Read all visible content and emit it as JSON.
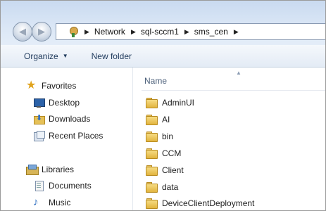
{
  "address": {
    "crumbs": [
      "Network",
      "sql-sccm1",
      "sms_cen"
    ]
  },
  "toolbar": {
    "organize_label": "Organize",
    "new_folder_label": "New folder"
  },
  "navpane": {
    "favorites_label": "Favorites",
    "desktop_label": "Desktop",
    "downloads_label": "Downloads",
    "recent_label": "Recent Places",
    "libraries_label": "Libraries",
    "documents_label": "Documents",
    "music_label": "Music"
  },
  "content": {
    "column_name": "Name",
    "files": [
      "AdminUI",
      "AI",
      "bin",
      "CCM",
      "Client",
      "data",
      "DeviceClientDeployment"
    ]
  },
  "colors": {
    "chrome_top": "#c9daf0",
    "toolbar_text": "#1e395b",
    "folder": "#e2b43e"
  },
  "icons": [
    "back-icon",
    "forward-icon",
    "network-icon",
    "star-icon",
    "desktop-icon",
    "downloads-icon",
    "recent-places-icon",
    "libraries-icon",
    "documents-icon",
    "music-icon",
    "folder-icon"
  ]
}
